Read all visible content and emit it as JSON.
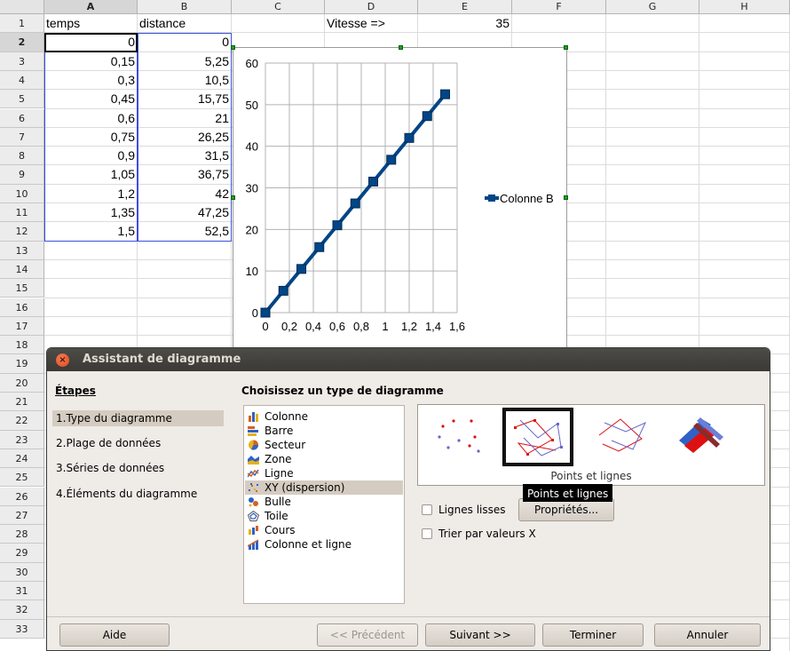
{
  "spreadsheet": {
    "columns": [
      "A",
      "B",
      "C",
      "D",
      "E",
      "F",
      "G",
      "H"
    ],
    "rows": [
      "1",
      "2",
      "3",
      "4",
      "5",
      "6",
      "7",
      "8",
      "9",
      "10",
      "11",
      "12",
      "13",
      "14",
      "15",
      "16",
      "17",
      "18",
      "19",
      "20",
      "21",
      "22",
      "23",
      "24",
      "25",
      "26",
      "27",
      "28",
      "29",
      "30",
      "31",
      "32",
      "33"
    ],
    "selected_row": "2",
    "selected_column": "A",
    "header_row": {
      "a1": "temps",
      "b1": "distance",
      "d1": "Vitesse =>",
      "e1": "35"
    },
    "temps": [
      "0",
      "0,15",
      "0,3",
      "0,45",
      "0,6",
      "0,75",
      "0,9",
      "1,05",
      "1,2",
      "1,35",
      "1,5"
    ],
    "distance": [
      "0",
      "5,25",
      "10,5",
      "15,75",
      "21",
      "26,25",
      "31,5",
      "36,75",
      "42",
      "47,25",
      "52,5"
    ]
  },
  "chart_data": {
    "type": "scatter",
    "x": [
      0,
      0.15,
      0.3,
      0.45,
      0.6,
      0.75,
      0.9,
      1.05,
      1.2,
      1.35,
      1.5
    ],
    "series": [
      {
        "name": "Colonne B",
        "values": [
          0,
          5.25,
          10.5,
          15.75,
          21,
          26.25,
          31.5,
          36.75,
          42,
          47.25,
          52.5
        ]
      }
    ],
    "x_tick_labels": [
      "0",
      "0,2",
      "0,4",
      "0,6",
      "0,8",
      "1",
      "1,2",
      "1,4",
      "1,6"
    ],
    "y_tick_labels": [
      "0",
      "10",
      "20",
      "30",
      "40",
      "50",
      "60"
    ],
    "xlim": [
      0,
      1.6
    ],
    "ylim": [
      0,
      60
    ],
    "grid": true,
    "legend_position": "right",
    "line_color": "#004586"
  },
  "dialog": {
    "title": "Assistant de diagramme",
    "steps_title": "Étapes",
    "steps": [
      "1.Type du diagramme",
      "2.Plage de données",
      "3.Séries de données",
      "4.Éléments du diagramme"
    ],
    "selected_step": "1.Type du diagramme",
    "main_title": "Choisissez un type de diagramme",
    "chart_types": [
      {
        "label": "Colonne",
        "icon": "column-chart-icon"
      },
      {
        "label": "Barre",
        "icon": "bar-chart-icon"
      },
      {
        "label": "Secteur",
        "icon": "pie-chart-icon"
      },
      {
        "label": "Zone",
        "icon": "area-chart-icon"
      },
      {
        "label": "Ligne",
        "icon": "line-chart-icon"
      },
      {
        "label": "XY (dispersion)",
        "icon": "scatter-chart-icon"
      },
      {
        "label": "Bulle",
        "icon": "bubble-chart-icon"
      },
      {
        "label": "Toile",
        "icon": "net-chart-icon"
      },
      {
        "label": "Cours",
        "icon": "stock-chart-icon"
      },
      {
        "label": "Colonne et ligne",
        "icon": "column-line-chart-icon"
      }
    ],
    "selected_type": "XY (dispersion)",
    "variant_label": "Points et lignes",
    "tooltip": "Points et lignes",
    "smooth_lines_label": "Lignes lisses",
    "properties_button": "Propriétés...",
    "sort_x_label": "Trier par valeurs X",
    "buttons": {
      "help": "Aide",
      "previous": "<< Précédent",
      "next": "Suivant >>",
      "finish": "Terminer",
      "cancel": "Annuler"
    }
  }
}
